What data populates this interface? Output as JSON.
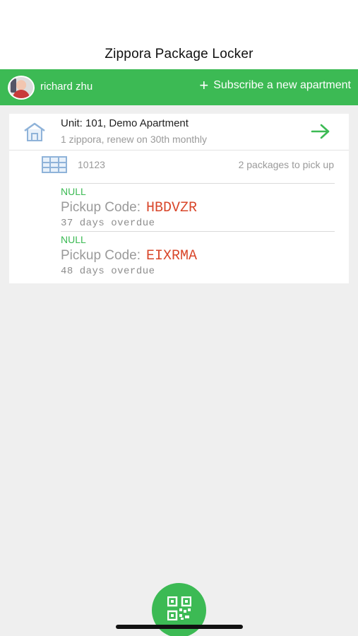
{
  "header": {
    "title": "Zippora Package Locker"
  },
  "user_bar": {
    "user_name": "richard zhu",
    "subscribe_label": "Subscribe a new apartment",
    "bar_color": "#3cba54"
  },
  "apartment": {
    "title": "Unit: 101, Demo Apartment",
    "subtitle": "1 zippora, renew on 30th monthly",
    "icon": "home-icon",
    "action_icon": "arrow-right-icon"
  },
  "locker": {
    "id": "10123",
    "count_text": "2 packages to pick up",
    "icon": "locker-grid-icon"
  },
  "packages": [
    {
      "status": "NULL",
      "code_label": "Pickup Code:",
      "code": "HBDVZR",
      "overdue": "37 days overdue"
    },
    {
      "status": "NULL",
      "code_label": "Pickup Code:",
      "code": "EIXRMA",
      "overdue": "48 days overdue"
    }
  ],
  "fab": {
    "icon": "qr-code-icon"
  },
  "colors": {
    "accent": "#3cba54",
    "code": "#d9472b"
  }
}
